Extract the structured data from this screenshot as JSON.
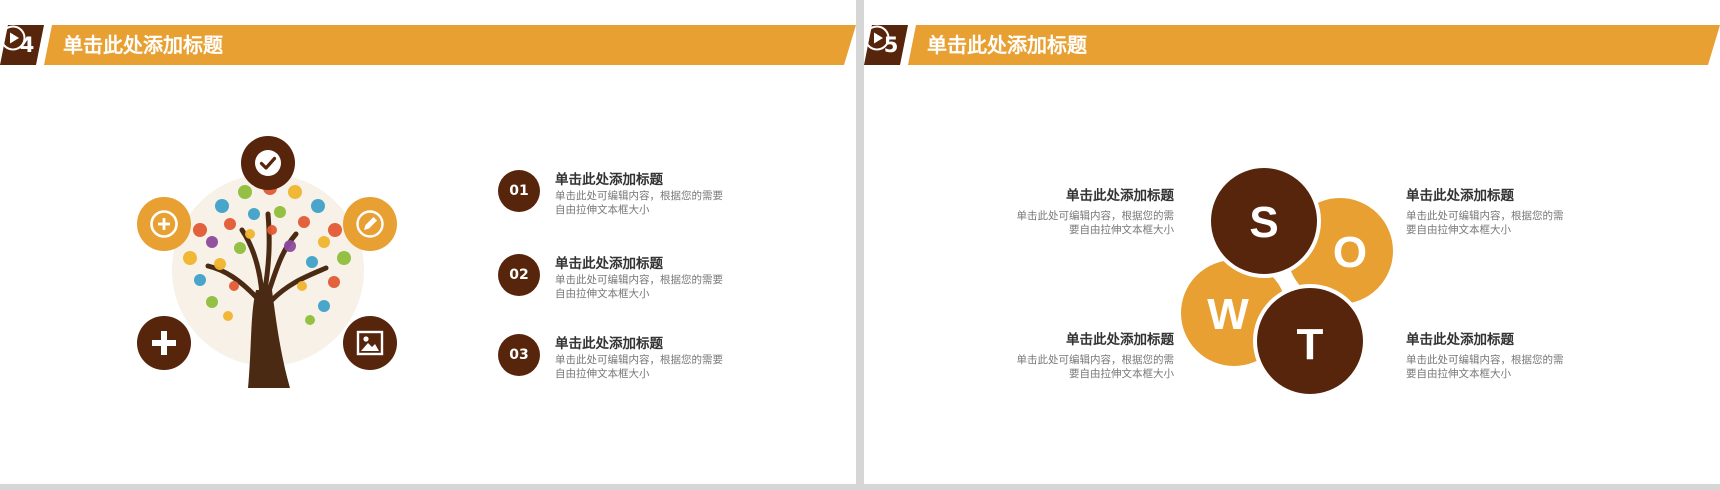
{
  "colors": {
    "orange": "#e9a032",
    "brown": "#57240c",
    "bg": "#ffffff",
    "divider": "#d6d6d6"
  },
  "left_slide": {
    "number": "4",
    "title": "单击此处添加标题",
    "icons": [
      "check-icon",
      "plus-circle-icon",
      "pencil-icon",
      "plus-icon",
      "image-icon",
      "play-icon"
    ],
    "items": [
      {
        "num": "01",
        "title": "单击此处添加标题",
        "desc": "单击此处可编辑内容，根据您的需要自由拉伸文本框大小"
      },
      {
        "num": "02",
        "title": "单击此处添加标题",
        "desc": "单击此处可编辑内容，根据您的需要自由拉伸文本框大小"
      },
      {
        "num": "03",
        "title": "单击此处添加标题",
        "desc": "单击此处可编辑内容，根据您的需要自由拉伸文本框大小"
      }
    ]
  },
  "right_slide": {
    "number": "5",
    "title": "单击此处添加标题",
    "swot": {
      "s": "S",
      "o": "O",
      "w": "W",
      "t": "T"
    },
    "blocks": [
      {
        "title": "单击此处添加标题",
        "desc": "单击此处可编辑内容，根据您的需要自由拉伸文本框大小"
      },
      {
        "title": "单击此处添加标题",
        "desc": "单击此处可编辑内容，根据您的需要自由拉伸文本框大小"
      },
      {
        "title": "单击此处添加标题",
        "desc": "单击此处可编辑内容，根据您的需要自由拉伸文本框大小"
      },
      {
        "title": "单击此处添加标题",
        "desc": "单击此处可编辑内容，根据您的需要自由拉伸文本框大小"
      }
    ]
  }
}
